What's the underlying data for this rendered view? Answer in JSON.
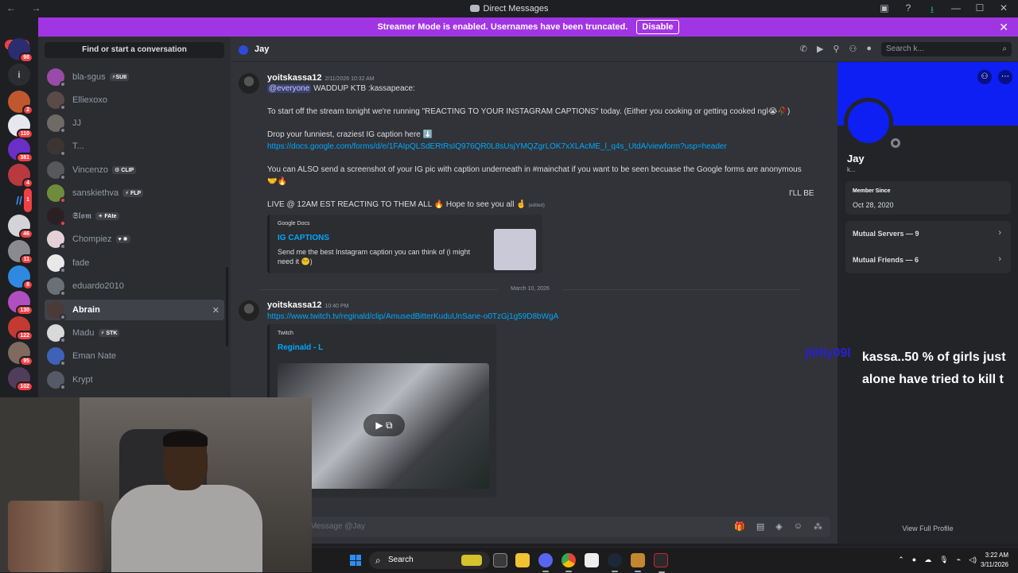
{
  "window": {
    "title": "Direct Messages"
  },
  "banner": {
    "text": "Streamer Mode is enabled. Usernames have been truncated.",
    "disable_label": "Disable",
    "color": "#a135e3"
  },
  "servers": {
    "new_label": "NEW",
    "badges": [
      "98",
      "2",
      "110",
      "381",
      "4",
      "1",
      "46",
      "11",
      "8",
      "130",
      "122",
      "95",
      "102"
    ]
  },
  "dm_list": {
    "search_placeholder": "Find or start a conversation",
    "items": [
      {
        "name": "bla-sgus",
        "tag": "⚡SUII"
      },
      {
        "name": "Elliexoxo",
        "tag": ""
      },
      {
        "name": "JJ",
        "tag": ""
      },
      {
        "name": "T...",
        "tag": ""
      },
      {
        "name": "Vincenzo",
        "tag": "⚙ CLIP"
      },
      {
        "name": "sanskiethva",
        "tag": "⚡ FLP"
      },
      {
        "name": "𝕾𝖑𝖔𝖒",
        "tag": "☀ FAte"
      },
      {
        "name": "Chompiez",
        "tag": "♥ ✺"
      },
      {
        "name": "fade",
        "tag": ""
      },
      {
        "name": "eduardo2010",
        "tag": ""
      },
      {
        "name": "Abrain",
        "tag": "",
        "active": true
      },
      {
        "name": "Madu",
        "tag": "⚡ STK"
      },
      {
        "name": "Eman Nate",
        "tag": ""
      },
      {
        "name": "Krypt",
        "tag": ""
      }
    ]
  },
  "chat_header": {
    "name": "Jay",
    "search_placeholder": "Search k..."
  },
  "messages": [
    {
      "author": "yoitskassa12",
      "time": "2/11/2026 10:32 AM",
      "mention": "@everyone",
      "line1": " WADDUP KTB :kassapeace:",
      "line2": "To start off the stream tonight we're running \"REACTING TO YOUR INSTAGRAM CAPTIONS\" today. (Either you cooking or getting cooked ngl😭🥀)",
      "line3": "Drop your funniest, craziest IG caption here ⬇️",
      "link": "https://docs.google.com/forms/d/e/1FAIpQLSdERtRsIQ976QR0L8sUsjYMQZgrLOK7xXLAcME_l_q4s_UtdA/viewform?usp=header",
      "line4": "You can ALSO send a screenshot of your IG pic with caption underneath in #mainchat if you want to be seen becuase the Google forms are anonymous",
      "line4b": "🤝🔥",
      "line4c": "I'LL BE",
      "line5": "LIVE @ 12AM EST REACTING TO THEM ALL 🔥 Hope to see you all 🤞",
      "edited": "(edited)",
      "embed": {
        "provider": "Google Docs",
        "title": "IG CAPTIONS",
        "desc1": "Send me the best Instagram caption you can think of (i might",
        "desc2": "need it 😵‍💫)"
      }
    },
    {
      "date_separator": "March 10, 2026",
      "author": "yoitskassa12",
      "time": "10:40 PM",
      "link": "https://www.twitch.tv/reginald/clip/AmusedBitterKuduUnSane-o0TzGj1g59D8bWgA",
      "embed": {
        "provider": "Twitch",
        "title": "Reginald - L"
      }
    }
  ],
  "composer": {
    "placeholder": "Message @Jay"
  },
  "profile": {
    "name": "Jay",
    "sub": "k...",
    "member_since_label": "Member Since",
    "member_since": "Oct 28, 2020",
    "mutual_servers": "Mutual Servers — 9",
    "mutual_friends": "Mutual Friends — 6",
    "view_full": "View Full Profile",
    "banner_color": "#0d1ff2"
  },
  "stream_overlay": {
    "user": "jl0lly09l",
    "line1": "kassa..50 % of girls just",
    "line2": "alone have tried to kill t"
  },
  "taskbar": {
    "search_label": "Search",
    "time": "3:22 AM",
    "date": "3/11/2026"
  }
}
